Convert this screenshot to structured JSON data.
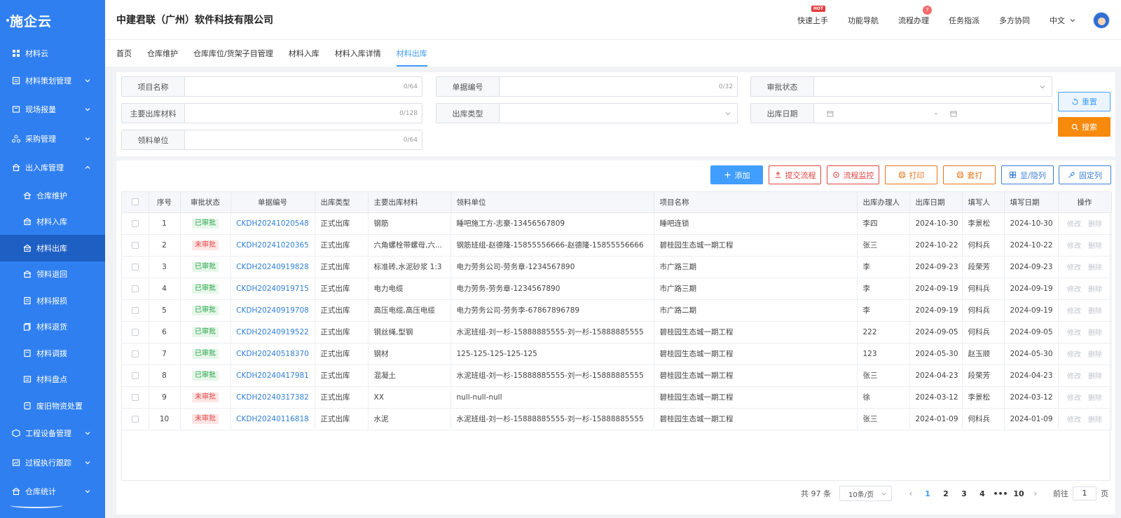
{
  "sidebar": {
    "logo": "施企云",
    "items": [
      {
        "label": "材料云",
        "icon": "grid-icon"
      },
      {
        "label": "材料策划管理",
        "icon": "plan-icon"
      },
      {
        "label": "现场报量",
        "icon": "report-icon"
      },
      {
        "label": "采购管理",
        "icon": "purchase-icon"
      },
      {
        "label": "出入库管理",
        "icon": "warehouse-icon"
      },
      {
        "label": "仓库维护",
        "icon": "house-icon"
      },
      {
        "label": "材料入库",
        "icon": "inbound-icon"
      },
      {
        "label": "材料出库",
        "icon": "outbound-icon"
      },
      {
        "label": "领料退回",
        "icon": "return-icon"
      },
      {
        "label": "材料报损",
        "icon": "damage-icon"
      },
      {
        "label": "材料退货",
        "icon": "refund-icon"
      },
      {
        "label": "材料调拨",
        "icon": "transfer-icon"
      },
      {
        "label": "材料盘点",
        "icon": "inventory-icon"
      },
      {
        "label": "废旧物资处置",
        "icon": "dispose-icon"
      },
      {
        "label": "工程设备管理",
        "icon": "device-icon"
      },
      {
        "label": "过程执行跟踪",
        "icon": "track-icon"
      },
      {
        "label": "仓库统计",
        "icon": "stats-icon"
      }
    ]
  },
  "header": {
    "company": "中建君联（广州）软件科技有限公司",
    "nav": [
      "快速上手",
      "功能导航",
      "流程办理",
      "任务指派",
      "多方协同"
    ],
    "hot_label": "HOT",
    "flow_badge": "7",
    "language": "中文"
  },
  "tabs": [
    "首页",
    "仓库维护",
    "仓库库位/货架子目管理",
    "材料入库",
    "材料入库详情",
    "材料出库"
  ],
  "filter": {
    "project_name": {
      "label": "项目名称",
      "count": "0/64"
    },
    "doc_no": {
      "label": "单据编号",
      "count": "0/32"
    },
    "approval_status": {
      "label": "审批状态"
    },
    "main_material": {
      "label": "主要出库材料",
      "count": "0/128"
    },
    "out_type": {
      "label": "出库类型"
    },
    "out_date": {
      "label": "出库日期",
      "separator": "-"
    },
    "receiver": {
      "label": "领料单位",
      "count": "0/64"
    },
    "reset_label": "重置",
    "search_label": "搜索"
  },
  "toolbar": {
    "add": "添加",
    "submit_flow": "提交流程",
    "flow_monitor": "流程监控",
    "print": "打印",
    "template_print": "套打",
    "show_hide": "显/隐列",
    "fix_col": "固定列"
  },
  "table": {
    "headers": [
      "序号",
      "审批状态",
      "单据编号",
      "出库类型",
      "主要出库材料",
      "领料单位",
      "项目名称",
      "出库办理人",
      "出库日期",
      "填写人",
      "填写日期",
      "操作"
    ],
    "edit_label": "修改",
    "delete_label": "删除",
    "rows": [
      {
        "no": "1",
        "status": "已审批",
        "approved": true,
        "doc": "CKDH20241020548",
        "type": "正式出库",
        "material": "钢筋",
        "receiver": "睡吧施工方-志豪-13456567809",
        "project": "睡吧连锁",
        "handler": "李四",
        "out_date": "2024-10-30",
        "writer": "李景松",
        "write_date": "2024-10-30"
      },
      {
        "no": "2",
        "status": "未审批",
        "approved": false,
        "doc": "CKDH20241020365",
        "type": "正式出库",
        "material": "六角螺栓带螺母,六...",
        "receiver": "钢筋班组-赵德隆-15855556666-赵德隆-15855556666",
        "project": "碧桂园生态城一期工程",
        "handler": "张三",
        "out_date": "2024-10-22",
        "writer": "何科兵",
        "write_date": "2024-10-22"
      },
      {
        "no": "3",
        "status": "已审批",
        "approved": true,
        "doc": "CKDH20240919828",
        "type": "正式出库",
        "material": "标准砖,水泥砂浆 1:3",
        "receiver": "电力劳务公司-劳务章-1234567890",
        "project": "市广路三期",
        "handler": "李",
        "out_date": "2024-09-23",
        "writer": "段荣芳",
        "write_date": "2024-09-23"
      },
      {
        "no": "4",
        "status": "已审批",
        "approved": true,
        "doc": "CKDH20240919715",
        "type": "正式出库",
        "material": "电力电缆",
        "receiver": "电力劳务-劳务章-1234567890",
        "project": "市广路三期",
        "handler": "李",
        "out_date": "2024-09-19",
        "writer": "何科兵",
        "write_date": "2024-09-19"
      },
      {
        "no": "5",
        "status": "已审批",
        "approved": true,
        "doc": "CKDH20240919708",
        "type": "正式出库",
        "material": "高压电缆,高压电缆",
        "receiver": "电力劳务公司-劳务李-67867896789",
        "project": "市广路二期",
        "handler": "李",
        "out_date": "2024-09-19",
        "writer": "何科兵",
        "write_date": "2024-09-19"
      },
      {
        "no": "6",
        "status": "已审批",
        "approved": true,
        "doc": "CKDH20240919522",
        "type": "正式出库",
        "material": "钢丝绳,型钢",
        "receiver": "水泥班组-刘一杉-15888885555-刘一杉-15888885555",
        "project": "碧桂园生态城一期工程",
        "handler": "222",
        "out_date": "2024-09-05",
        "writer": "何科兵",
        "write_date": "2024-09-05"
      },
      {
        "no": "7",
        "status": "已审批",
        "approved": true,
        "doc": "CKDH20240518370",
        "type": "正式出库",
        "material": "钢材",
        "receiver": "125-125-125-125-125",
        "project": "碧桂园生态城一期工程",
        "handler": "123",
        "out_date": "2024-05-30",
        "writer": "赵玉顺",
        "write_date": "2024-05-30"
      },
      {
        "no": "8",
        "status": "已审批",
        "approved": true,
        "doc": "CKDH20240417981",
        "type": "正式出库",
        "material": "混凝土",
        "receiver": "水泥班组-刘一杉-15888885555-刘一杉-15888885555",
        "project": "碧桂园生态城一期工程",
        "handler": "张三",
        "out_date": "2024-04-23",
        "writer": "段荣芳",
        "write_date": "2024-04-23"
      },
      {
        "no": "9",
        "status": "未审批",
        "approved": false,
        "doc": "CKDH20240317382",
        "type": "正式出库",
        "material": "XX",
        "receiver": "null-null-null",
        "project": "碧桂园生态城一期工程",
        "handler": "徐",
        "out_date": "2024-03-12",
        "writer": "李景松",
        "write_date": "2024-03-12"
      },
      {
        "no": "10",
        "status": "未审批",
        "approved": false,
        "doc": "CKDH20240116818",
        "type": "正式出库",
        "material": "水泥",
        "receiver": "水泥班组-刘一杉-15888885555-刘一杉-15888885555",
        "project": "碧桂园生态城一期工程",
        "handler": "张三",
        "out_date": "2024-01-09",
        "writer": "何科兵",
        "write_date": "2024-01-09"
      }
    ]
  },
  "pagination": {
    "total": "共 97 条",
    "page_size": "10条/页",
    "pages": [
      "1",
      "2",
      "3",
      "4",
      "•••",
      "10"
    ],
    "current": "1",
    "goto_prefix": "前往",
    "goto_value": "1",
    "goto_suffix": "页"
  },
  "colors": {
    "sidebar": "#2f7ff0",
    "sidebar_active": "#1e5fc4",
    "primary": "#409eff",
    "search": "#f7890c",
    "approved": "#2ba44a",
    "pending": "#e04646"
  }
}
